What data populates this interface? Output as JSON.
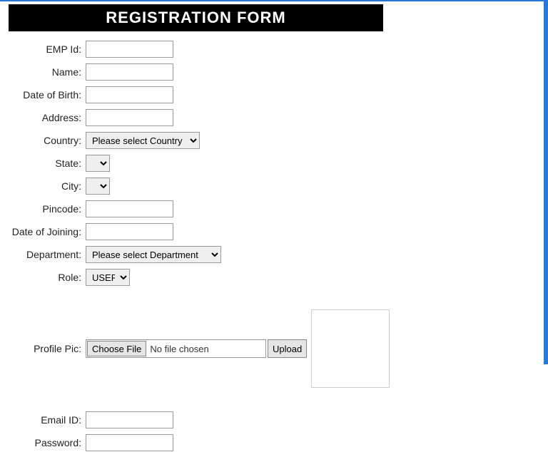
{
  "header": {
    "title": "REGISTRATION FORM"
  },
  "fields": {
    "empId": {
      "label": "EMP Id:",
      "value": ""
    },
    "name": {
      "label": "Name:",
      "value": ""
    },
    "dob": {
      "label": "Date of Birth:",
      "value": ""
    },
    "address": {
      "label": "Address:",
      "value": ""
    },
    "country": {
      "label": "Country:",
      "selected": "Please select Country"
    },
    "state": {
      "label": "State:",
      "selected": ""
    },
    "city": {
      "label": "City:",
      "selected": ""
    },
    "pincode": {
      "label": "Pincode:",
      "value": ""
    },
    "doj": {
      "label": "Date of Joining:",
      "value": ""
    },
    "department": {
      "label": "Department:",
      "selected": "Please select Department"
    },
    "role": {
      "label": "Role:",
      "selected": "USER"
    },
    "profilePic": {
      "label": "Profile Pic:",
      "chooseBtn": "Choose File",
      "status": "No file chosen",
      "uploadBtn": "Upload"
    },
    "emailId": {
      "label": "Email ID:",
      "value": ""
    },
    "password": {
      "label": "Password:",
      "value": ""
    }
  }
}
